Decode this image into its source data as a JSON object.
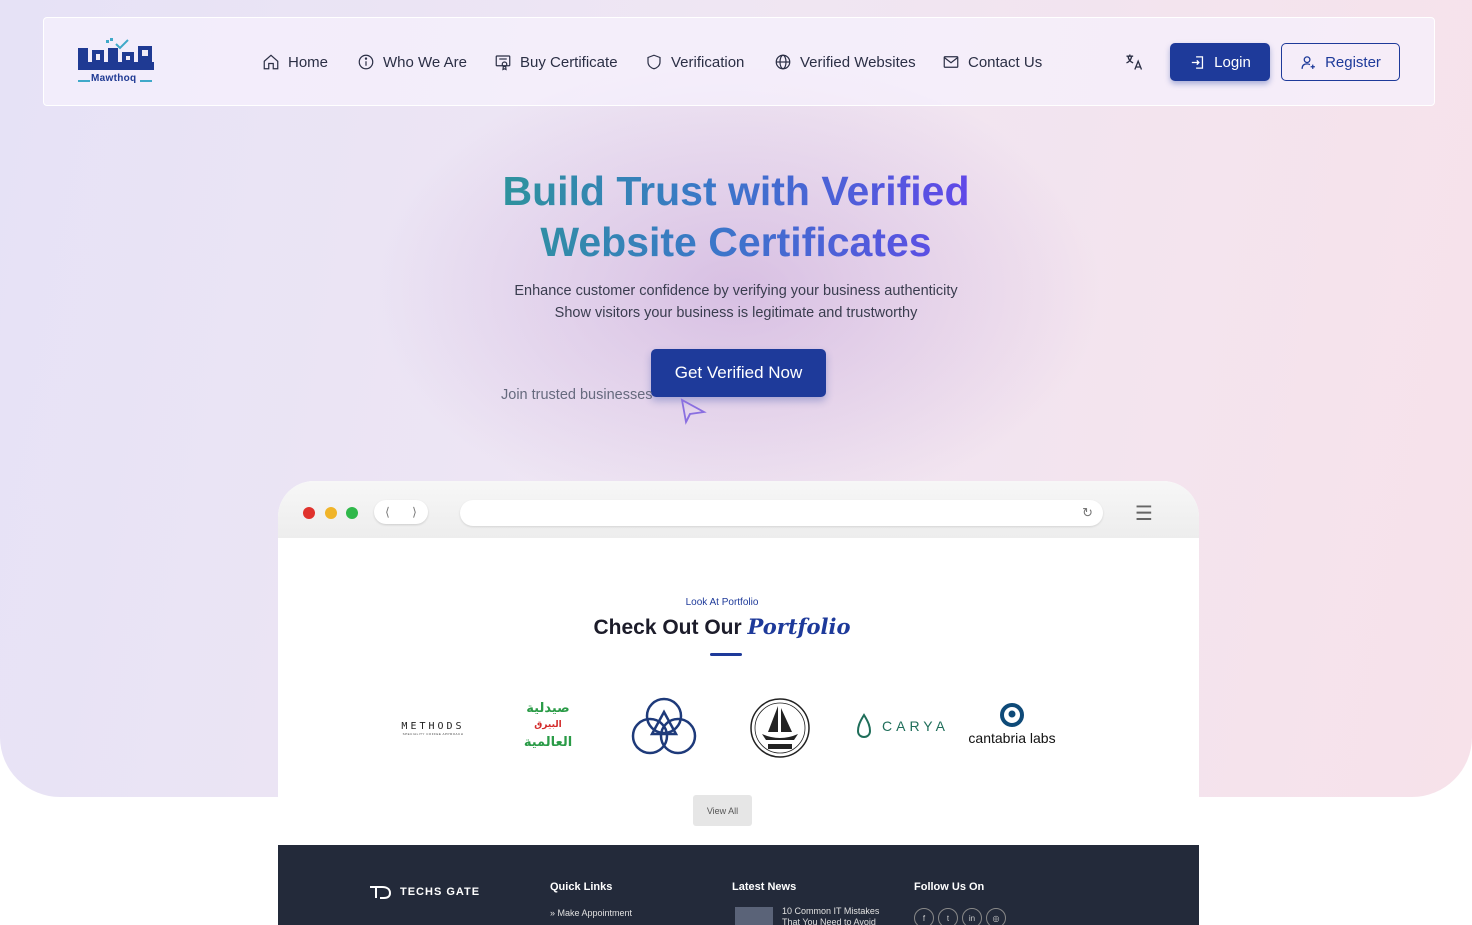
{
  "nav": {
    "logo_text": "Mawthoq",
    "items": [
      {
        "label": "Home",
        "icon": "home-icon"
      },
      {
        "label": "Who We Are",
        "icon": "info-icon"
      },
      {
        "label": "Buy Certificate",
        "icon": "certificate-icon"
      },
      {
        "label": "Verification",
        "icon": "shield-icon"
      },
      {
        "label": "Verified Websites",
        "icon": "globe-icon"
      },
      {
        "label": "Contact Us",
        "icon": "mail-icon"
      }
    ],
    "language_icon": "translate-icon",
    "login_label": "Login",
    "register_label": "Register"
  },
  "hero": {
    "headline_line1": "Build Trust with Verified",
    "headline_line2": "Website Certificates",
    "subtitle_line1": "Enhance customer confidence by verifying your business authenticity",
    "subtitle_line2": "Show visitors your business is legitimate and trustworthy",
    "cta_label": "Get Verified Now",
    "join_text": "Join trusted businesses"
  },
  "preview": {
    "eyebrow": "Look At Portfolio",
    "title_plain": "Check Out Our",
    "title_accent": "Portfolio",
    "partners": [
      {
        "name": "METHODS",
        "tagline": "SPECIALITY COFFEE APPROACH"
      },
      {
        "name_line1": "صيدلية",
        "name_line2": "البيرق",
        "name_line3": "العالمية"
      },
      {
        "name": "circle-triangle-logo"
      },
      {
        "name": "ship-emblem-logo"
      },
      {
        "name": "CARYA"
      },
      {
        "name": "cantabria labs"
      }
    ],
    "view_all_label": "View All",
    "footer": {
      "brand": "TECHS GATE",
      "quick_links_title": "Quick Links",
      "quick_link_1": "» Make Appointment",
      "latest_news_title": "Latest News",
      "news_1_line1": "10 Common IT Mistakes",
      "news_1_line2": "That You Need to Avoid",
      "follow_title": "Follow Us On"
    }
  },
  "colors": {
    "primary": "#1e3a9a",
    "headline_gradient_start": "#2a9b8f",
    "headline_gradient_end": "#6a3cf0",
    "footer_bg": "#232a3a"
  }
}
